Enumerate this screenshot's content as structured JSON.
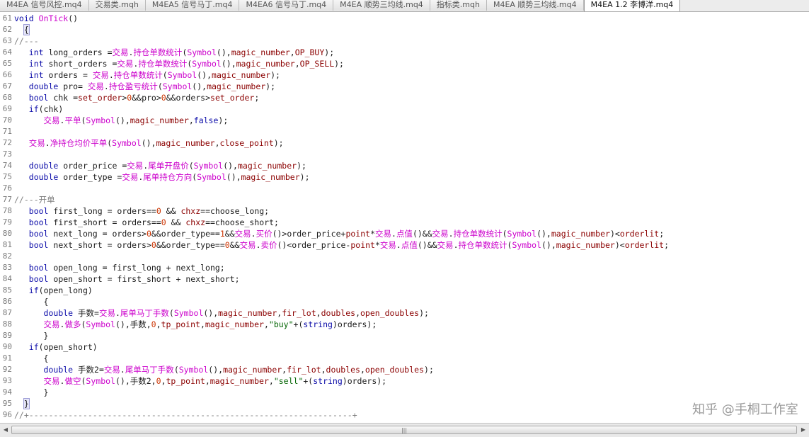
{
  "tabs": [
    {
      "label": "M4EA 信号风控.mq4",
      "active": false
    },
    {
      "label": "交易类.mqh",
      "active": false
    },
    {
      "label": "M4EA5 信号马丁.mq4",
      "active": false
    },
    {
      "label": "M4EA6 信号马丁.mq4",
      "active": false
    },
    {
      "label": "M4EA 顺势三均线.mq4",
      "active": false
    },
    {
      "label": "指标类.mqh",
      "active": false
    },
    {
      "label": "M4EA 顺势三均线.mq4",
      "active": false
    },
    {
      "label": "M4EA 1.2 李博洋.mq4",
      "active": true
    }
  ],
  "lines": [
    {
      "n": "61",
      "code": "void OnTick()"
    },
    {
      "n": "62",
      "code": "  {"
    },
    {
      "n": "63",
      "code": "//---"
    },
    {
      "n": "64",
      "code": "   int long_orders =交易.持仓单数统计(Symbol(),magic_number,OP_BUY);"
    },
    {
      "n": "65",
      "code": "   int short_orders =交易.持仓单数统计(Symbol(),magic_number,OP_SELL);"
    },
    {
      "n": "66",
      "code": "   int orders = 交易.持仓单数统计(Symbol(),magic_number);"
    },
    {
      "n": "67",
      "code": "   double pro= 交易.持仓盈亏统计(Symbol(),magic_number);"
    },
    {
      "n": "68",
      "code": "   bool chk =set_order>0&&pro>0&&orders>set_order;"
    },
    {
      "n": "69",
      "code": "   if(chk)"
    },
    {
      "n": "70",
      "code": "      交易.平单(Symbol(),magic_number,false);"
    },
    {
      "n": "71",
      "code": ""
    },
    {
      "n": "72",
      "code": "   交易.净持仓均价平单(Symbol(),magic_number,close_point);"
    },
    {
      "n": "73",
      "code": ""
    },
    {
      "n": "74",
      "code": "   double order_price =交易.尾单开盘价(Symbol(),magic_number);"
    },
    {
      "n": "75",
      "code": "   double order_type =交易.尾单持仓方向(Symbol(),magic_number);"
    },
    {
      "n": "76",
      "code": ""
    },
    {
      "n": "77",
      "code": "//---开单"
    },
    {
      "n": "78",
      "code": "   bool first_long = orders==0 && chxz==choose_long;"
    },
    {
      "n": "79",
      "code": "   bool first_short = orders==0 && chxz==choose_short;"
    },
    {
      "n": "80",
      "code": "   bool next_long = orders>0&&order_type==1&&交易.买价()>order_price+point*交易.点值()&&交易.持仓单数统计(Symbol(),magic_number)<orderlit;"
    },
    {
      "n": "81",
      "code": "   bool next_short = orders>0&&order_type==0&&交易.卖价()<order_price-point*交易.点值()&&交易.持仓单数统计(Symbol(),magic_number)<orderlit;"
    },
    {
      "n": "82",
      "code": ""
    },
    {
      "n": "83",
      "code": "   bool open_long = first_long + next_long;"
    },
    {
      "n": "84",
      "code": "   bool open_short = first_short + next_short;"
    },
    {
      "n": "85",
      "code": "   if(open_long)"
    },
    {
      "n": "86",
      "code": "      {"
    },
    {
      "n": "87",
      "code": "      double 手数=交易.尾单马丁手数(Symbol(),magic_number,fir_lot,doubles,open_doubles);"
    },
    {
      "n": "88",
      "code": "      交易.做多(Symbol(),手数,0,tp_point,magic_number,\"buy\"+(string)orders);"
    },
    {
      "n": "89",
      "code": "      }"
    },
    {
      "n": "90",
      "code": "   if(open_short)"
    },
    {
      "n": "91",
      "code": "      {"
    },
    {
      "n": "92",
      "code": "      double 手数2=交易.尾单马丁手数(Symbol(),magic_number,fir_lot,doubles,open_doubles);"
    },
    {
      "n": "93",
      "code": "      交易.做空(Symbol(),手数2,0,tp_point,magic_number,\"sell\"+(string)orders);"
    },
    {
      "n": "94",
      "code": "      }"
    },
    {
      "n": "95",
      "code": "  }"
    },
    {
      "n": "96",
      "code": "//+------------------------------------------------------------------+"
    }
  ],
  "syntax": {
    "keywords": [
      "void",
      "int",
      "double",
      "bool",
      "if",
      "string",
      "false"
    ],
    "functions": [
      "Symbol",
      "OnTick",
      "交易",
      "持仓单数统计",
      "持仓盈亏统计",
      "平单",
      "净持仓均价平单",
      "尾单开盘价",
      "尾单持仓方向",
      "买价",
      "卖价",
      "点值",
      "尾单马丁手数",
      "做多",
      "做空"
    ],
    "variables": [
      "magic_number",
      "OP_BUY",
      "OP_SELL",
      "set_order",
      "close_point",
      "chxz",
      "point",
      "orderlit",
      "fir_lot",
      "doubles",
      "open_doubles",
      "tp_point"
    ],
    "colors": {
      "keyword": "#0a0aa8",
      "function": "#cc00cc",
      "variable": "#8b0000",
      "comment": "#7f7f7f",
      "string": "#006400",
      "number": "#cc3300"
    }
  },
  "scrollbar": {
    "grip": "|||"
  },
  "watermark": "知乎 @手桐工作室"
}
